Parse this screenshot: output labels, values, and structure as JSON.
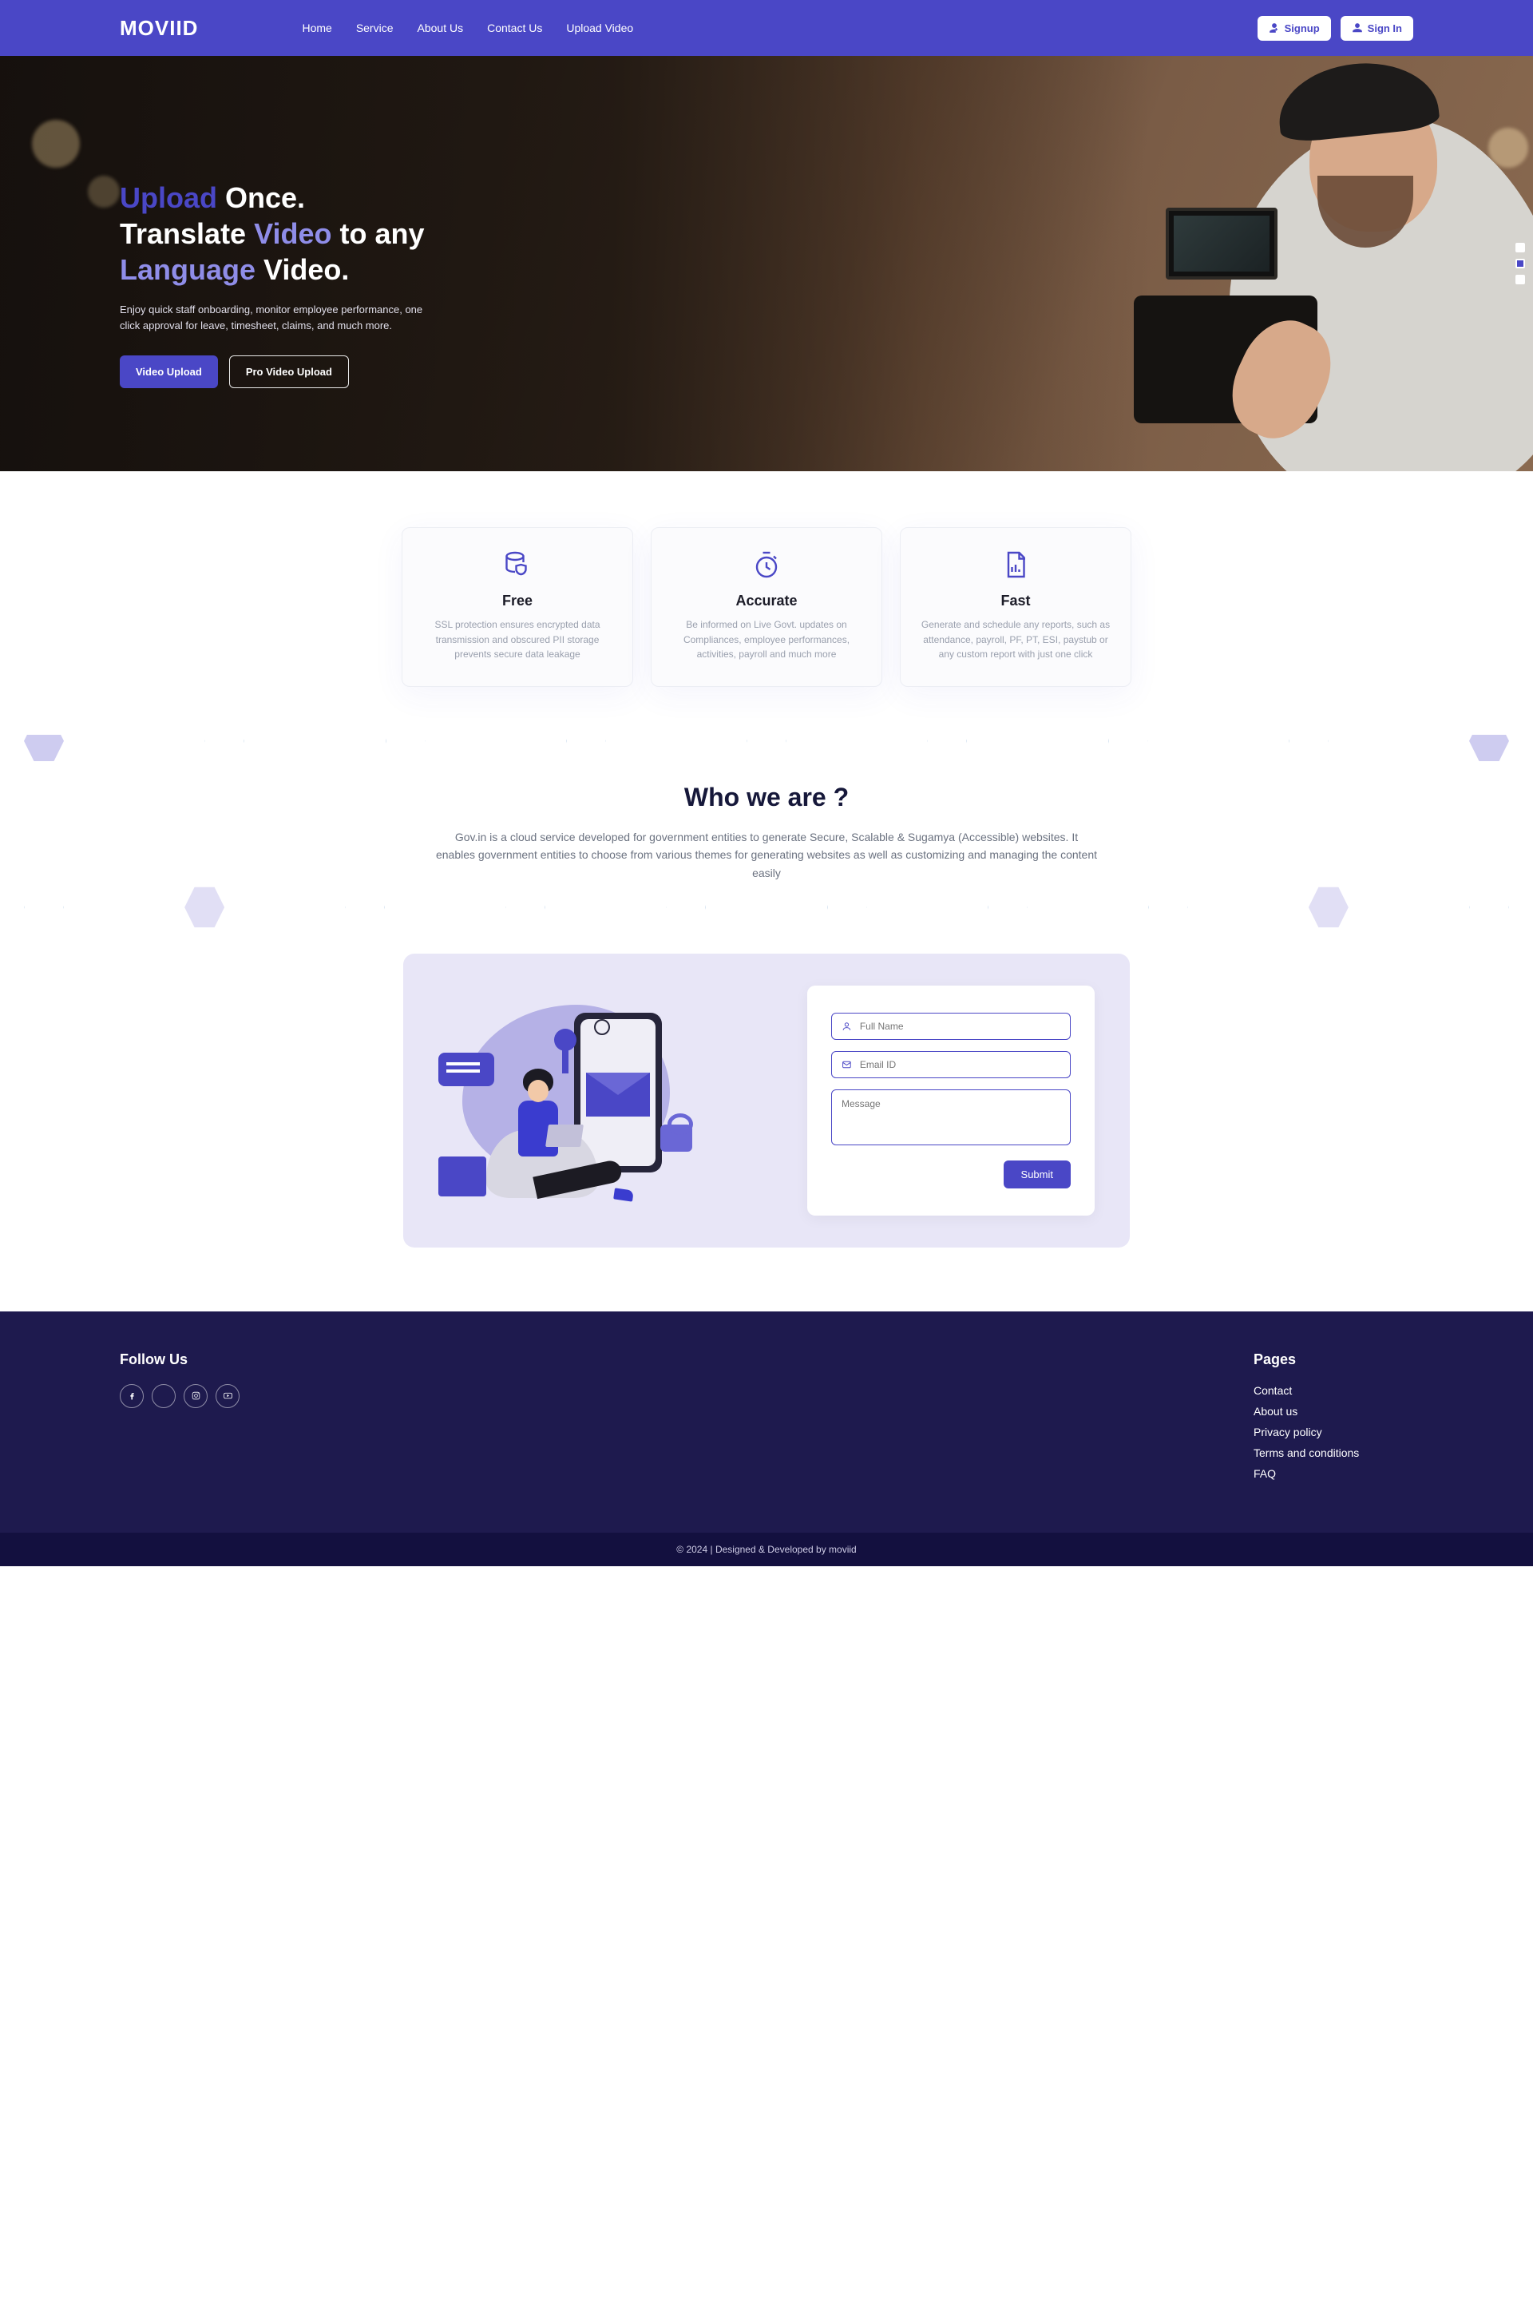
{
  "header": {
    "logo": "MOVIID",
    "nav": [
      "Home",
      "Service",
      "About Us",
      "Contact Us",
      "Upload Video"
    ],
    "signup": "Signup",
    "signin": "Sign In"
  },
  "hero": {
    "h1_parts": {
      "a": "Upload",
      "b": "Once.",
      "c": "Translate",
      "d": "Video",
      "e": "to any",
      "f": "Language",
      "g": "Video."
    },
    "subtitle": "Enjoy quick staff onboarding, monitor employee performance, one click approval for leave, timesheet, claims, and much more.",
    "btn_primary": "Video Upload",
    "btn_secondary": "Pro Video Upload"
  },
  "features": [
    {
      "title": "Free",
      "desc": "SSL protection ensures encrypted data transmission and obscured PII storage prevents secure data leakage"
    },
    {
      "title": "Accurate",
      "desc": "Be informed on Live Govt. updates on Compliances, employee performances, activities, payroll and much more"
    },
    {
      "title": "Fast",
      "desc": "Generate and schedule any reports, such as attendance, payroll, PF, PT, ESI, paystub or any custom report with just one click"
    }
  ],
  "who": {
    "title": "Who we are ?",
    "body": "Gov.in is a cloud service developed for government entities to generate Secure, Scalable & Sugamya (Accessible) websites. It enables government entities to choose from various themes for generating websites as well as customizing and managing the content easily"
  },
  "form": {
    "name_ph": "Full Name",
    "email_ph": "Email ID",
    "msg_ph": "Message",
    "submit": "Submit"
  },
  "footer": {
    "follow": "Follow Us",
    "pages_title": "Pages",
    "pages": [
      "Contact",
      "About us",
      "Privacy policy",
      "Terms and conditions",
      "FAQ"
    ],
    "copyright": "© 2024 | Designed & Developed by moviid"
  }
}
